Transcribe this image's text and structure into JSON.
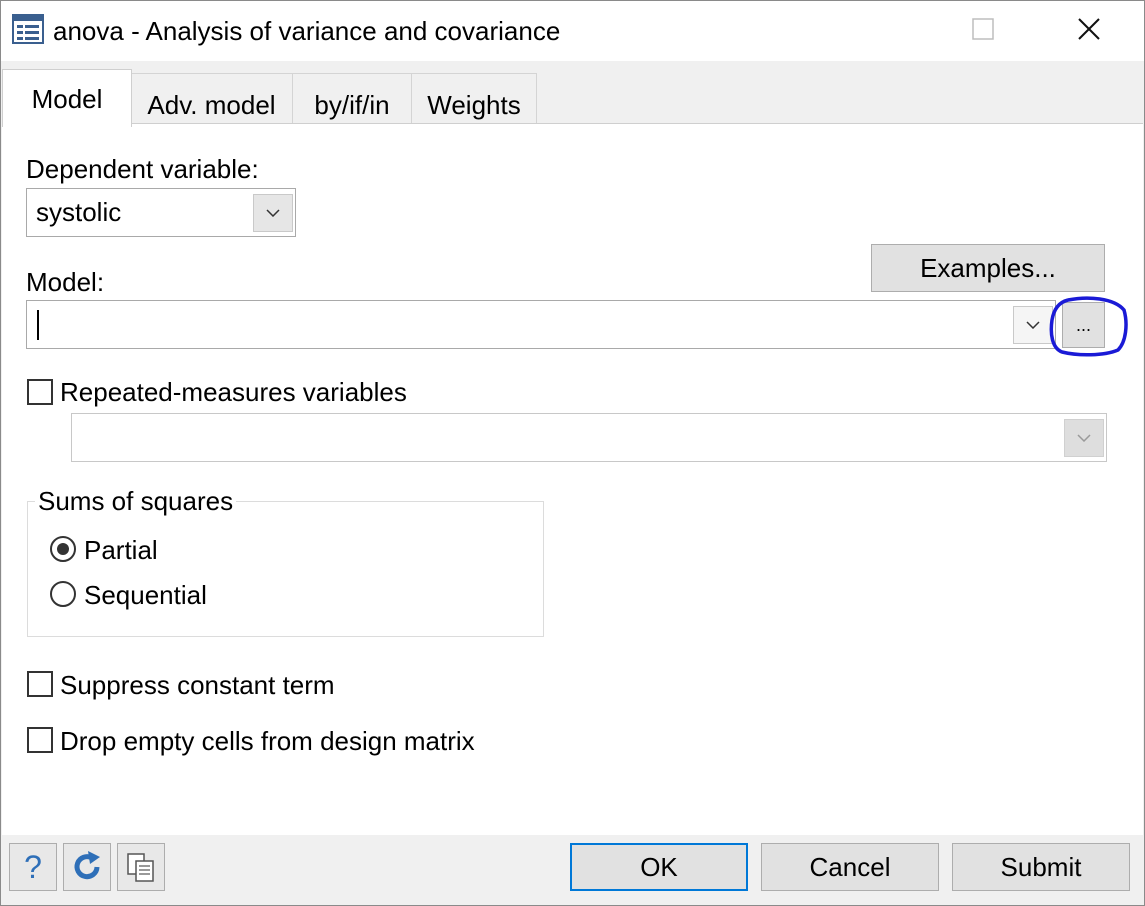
{
  "window": {
    "title": "anova - Analysis of variance and covariance",
    "icons": {
      "app": "dialog-app-icon",
      "maximize": "maximize-icon",
      "close": "close-icon"
    }
  },
  "tabs": [
    {
      "label": "Model",
      "active": true
    },
    {
      "label": "Adv. model",
      "active": false
    },
    {
      "label": "by/if/in",
      "active": false
    },
    {
      "label": "Weights",
      "active": false
    }
  ],
  "model_tab": {
    "dependent_variable": {
      "label": "Dependent variable:",
      "value": "systolic"
    },
    "examples_button": "Examples...",
    "model": {
      "label": "Model:",
      "value": "",
      "browse_button": "..."
    },
    "repeated_measures": {
      "label": "Repeated-measures variables",
      "checked": false,
      "value": ""
    },
    "sums_of_squares": {
      "title": "Sums of squares",
      "options": [
        {
          "label": "Partial",
          "selected": true
        },
        {
          "label": "Sequential",
          "selected": false
        }
      ]
    },
    "suppress_constant": {
      "label": "Suppress constant term",
      "checked": false
    },
    "drop_empty_cells": {
      "label": "Drop empty cells from design matrix",
      "checked": false
    }
  },
  "footer": {
    "icons": [
      "help-icon",
      "reset-icon",
      "copy-command-icon"
    ],
    "help_glyph": "?",
    "ok": "OK",
    "cancel": "Cancel",
    "submit": "Submit"
  },
  "colors": {
    "annotation": "#1a1ad6",
    "ok_border": "#0078d7",
    "icon_blue": "#2e6fb8"
  }
}
